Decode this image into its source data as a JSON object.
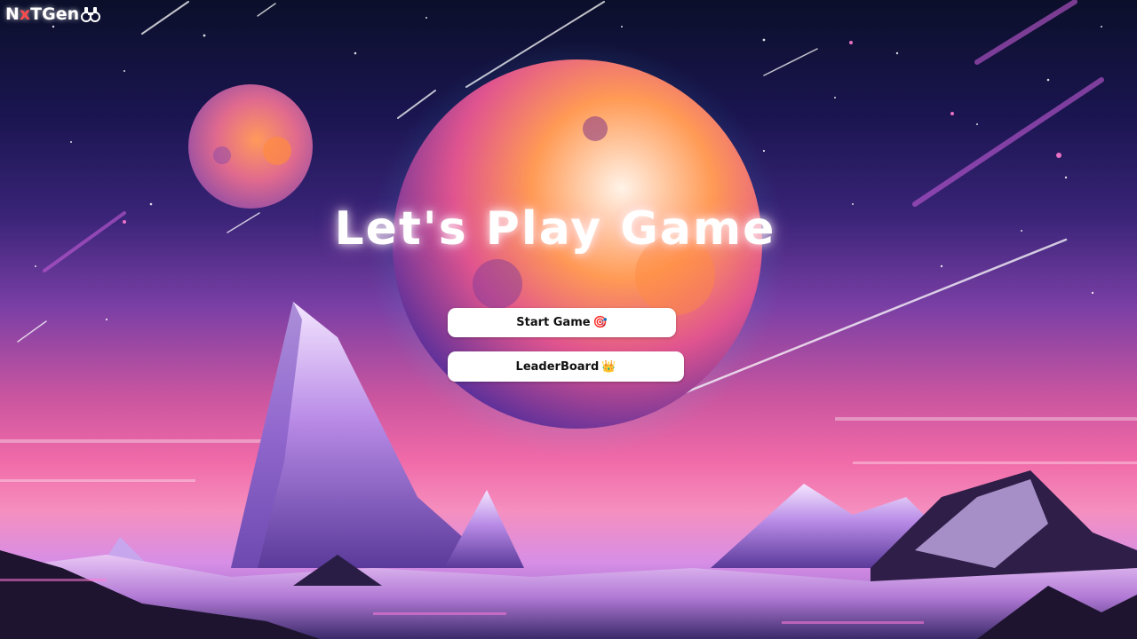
{
  "brand": {
    "logo_prefix": "N",
    "logo_x": "x",
    "logo_suffix": "TGen",
    "logo_icon": "binoculars-icon"
  },
  "main": {
    "title": "Let's Play Game",
    "start_button": {
      "label": "Start Game",
      "emoji": "🎯"
    },
    "leaderboard_button": {
      "label": "LeaderBoard",
      "emoji": "👑"
    }
  },
  "colors": {
    "button_bg": "#ffffff",
    "title_text": "#ffffff",
    "logo_accent": "#ff4a4a"
  }
}
